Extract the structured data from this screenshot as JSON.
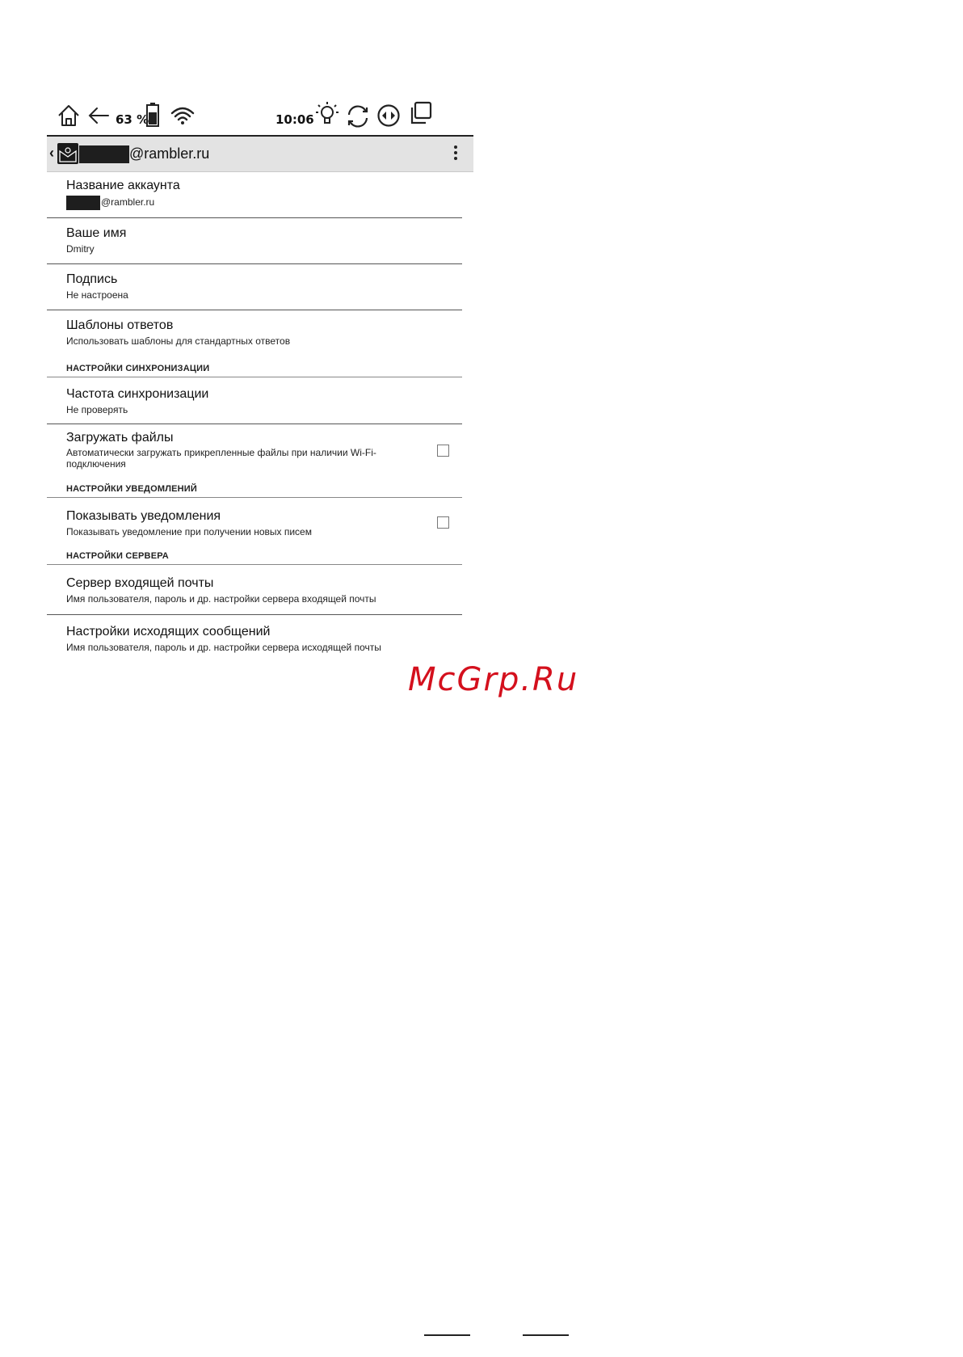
{
  "statusbar": {
    "battery_percent": "63 %",
    "battery_level": 0.63,
    "time": "10:06"
  },
  "appbar": {
    "account_suffix": "@rambler.ru"
  },
  "settings": {
    "account_name": {
      "title": "Название аккаунта",
      "value_suffix": "@rambler.ru"
    },
    "your_name": {
      "title": "Ваше имя",
      "value": "Dmitry"
    },
    "signature": {
      "title": "Подпись",
      "value": "Не настроена"
    },
    "reply_templates": {
      "title": "Шаблоны ответов",
      "value": "Использовать шаблоны для стандартных ответов"
    },
    "sync_section": "НАСТРОЙКИ СИНХРОНИЗАЦИИ",
    "sync_frequency": {
      "title": "Частота синхронизации",
      "value": "Не проверять"
    },
    "download_files": {
      "title": "Загружать файлы",
      "value_line1": "Автоматически загружать прикрепленные файлы при наличии Wi-Fi-",
      "value_line2": "подключения",
      "checked": false
    },
    "notif_section": "НАСТРОЙКИ УВЕДОМЛЕНИЙ",
    "show_notifications": {
      "title": "Показывать уведомления",
      "value": "Показывать уведомление при получении новых писем",
      "checked": false
    },
    "server_section": "НАСТРОЙКИ СЕРВЕРА",
    "incoming_server": {
      "title": "Сервер входящей почты",
      "value": "Имя пользователя, пароль и др. настройки сервера входящей почты"
    },
    "outgoing_settings": {
      "title": "Настройки исходящих сообщений",
      "value": "Имя пользователя, пароль и др. настройки сервера исходящей почты"
    }
  },
  "watermark": "McGrp.Ru",
  "icons": [
    "home-icon",
    "back-arrow-icon",
    "battery-icon",
    "wifi-icon",
    "light-icon",
    "sync-icon",
    "page-turn-icon",
    "task-switch-icon",
    "mail-icon",
    "more-menu-icon"
  ]
}
